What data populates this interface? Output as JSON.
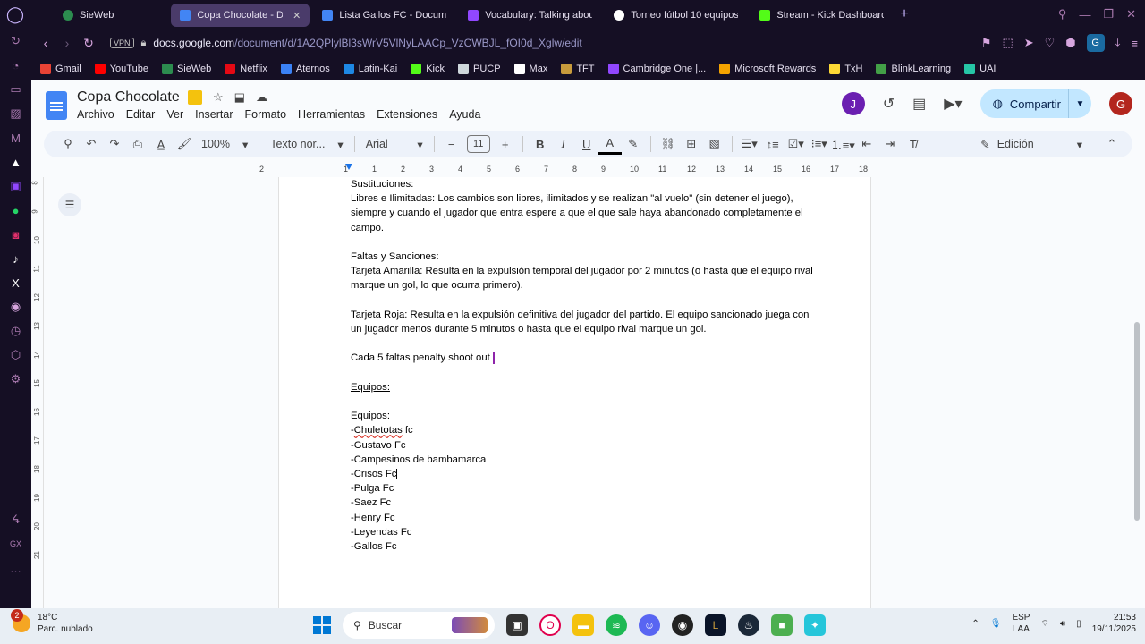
{
  "browser": {
    "tabs": [
      {
        "title": "SieWeb",
        "color": "#2c8c4f",
        "active": false
      },
      {
        "title": "Copa Chocolate - Docum",
        "color": "#4285f4",
        "active": true
      },
      {
        "title": "Lista Gallos FC - Docume",
        "color": "#4285f4",
        "active": false
      },
      {
        "title": "Vocabulary: Talking abou",
        "color": "#9147ff",
        "active": false
      },
      {
        "title": "Torneo fútbol 10 equipos",
        "color": "#ffffff",
        "active": false
      },
      {
        "title": "Stream - Kick Dashboard",
        "color": "#53fc18",
        "active": false
      }
    ],
    "address": {
      "vpn": "VPN",
      "host": "docs.google.com",
      "path": "/document/d/1A2QPlylBl3sWrV5VlNyLAACp_VzCWBJL_fOI0d_Xglw/edit"
    },
    "profile": "G",
    "bookmarks": [
      {
        "label": "Gmail",
        "color": "#ea4335"
      },
      {
        "label": "YouTube",
        "color": "#ff0000"
      },
      {
        "label": "SieWeb",
        "color": "#2c8c4f"
      },
      {
        "label": "Netflix",
        "color": "#e50914"
      },
      {
        "label": "Aternos",
        "color": "#3b82f6"
      },
      {
        "label": "Latin-Kai",
        "color": "#1e88e5"
      },
      {
        "label": "Kick",
        "color": "#53fc18"
      },
      {
        "label": "PUCP",
        "color": "#cfd8dc"
      },
      {
        "label": "Max",
        "color": "#ffffff"
      },
      {
        "label": "TFT",
        "color": "#c89b3c"
      },
      {
        "label": "Cambridge One |...",
        "color": "#9147ff"
      },
      {
        "label": "Microsoft Rewards",
        "color": "#f4a300"
      },
      {
        "label": "TxH",
        "color": "#fdd835"
      },
      {
        "label": "BlinkLearning",
        "color": "#43a047"
      },
      {
        "label": "UAI",
        "color": "#26c6a6"
      }
    ]
  },
  "docs": {
    "title": "Copa Chocolate",
    "menu": [
      "Archivo",
      "Editar",
      "Ver",
      "Insertar",
      "Formato",
      "Herramientas",
      "Extensiones",
      "Ayuda"
    ],
    "share_label": "Compartir",
    "avatar_j": "J",
    "avatar_g": "G",
    "toolbar": {
      "zoom": "100%",
      "style": "Texto nor...",
      "font": "Arial",
      "font_size": "11",
      "mode": "Edición"
    },
    "ruler_h": [
      "2",
      "1",
      "1",
      "2",
      "3",
      "4",
      "5",
      "6",
      "7",
      "8",
      "9",
      "10",
      "11",
      "12",
      "13",
      "14",
      "15",
      "16",
      "17",
      "18"
    ],
    "ruler_v": [
      "8",
      "9",
      "10",
      "11",
      "12",
      "13",
      "14",
      "15",
      "16",
      "17",
      "18",
      "19",
      "20",
      "21"
    ],
    "content": {
      "sust_head": "Sustituciones:",
      "sust_body": "Libres e Ilimitadas: Los cambios son libres, ilimitados y se realizan \"al vuelo\" (sin detener el juego), siempre y cuando el jugador que entra espere a que el que sale haya abandonado completamente el campo.",
      "faltas_head": "Faltas y Sanciones:",
      "amarilla": "Tarjeta Amarilla: Resulta en la expulsión temporal del jugador por 2 minutos (o hasta que el equipo rival marque un gol, lo que ocurra primero).",
      "roja": "Tarjeta Roja: Resulta en la expulsión definitiva del jugador del partido. El equipo sancionado juega con un jugador menos durante 5 minutos o hasta que el equipo rival marque un gol.",
      "penalty": "Cada 5 faltas penalty shoot out",
      "equipos_u": "Equipos:",
      "equipos": "Equipos:",
      "team1_prefix": "-",
      "team1_sq": "Chuletotas",
      "team1_rest": " fc",
      "team2": "-Gustavo Fc",
      "team3": "-Campesinos de bambamarca",
      "team4": "-Crisos Fc",
      "team5": "-Pulga Fc",
      "team6": "-Saez Fc",
      "team7": "-Henry Fc",
      "team8": "-Leyendas Fc",
      "team9": "-Gallos Fc"
    }
  },
  "taskbar": {
    "badge": "2",
    "temp": "18°C",
    "weather": "Parc. nublado",
    "search": "Buscar",
    "lang1": "ESP",
    "lang2": "LAA",
    "time": "21:53",
    "date": "19/11/2025"
  }
}
